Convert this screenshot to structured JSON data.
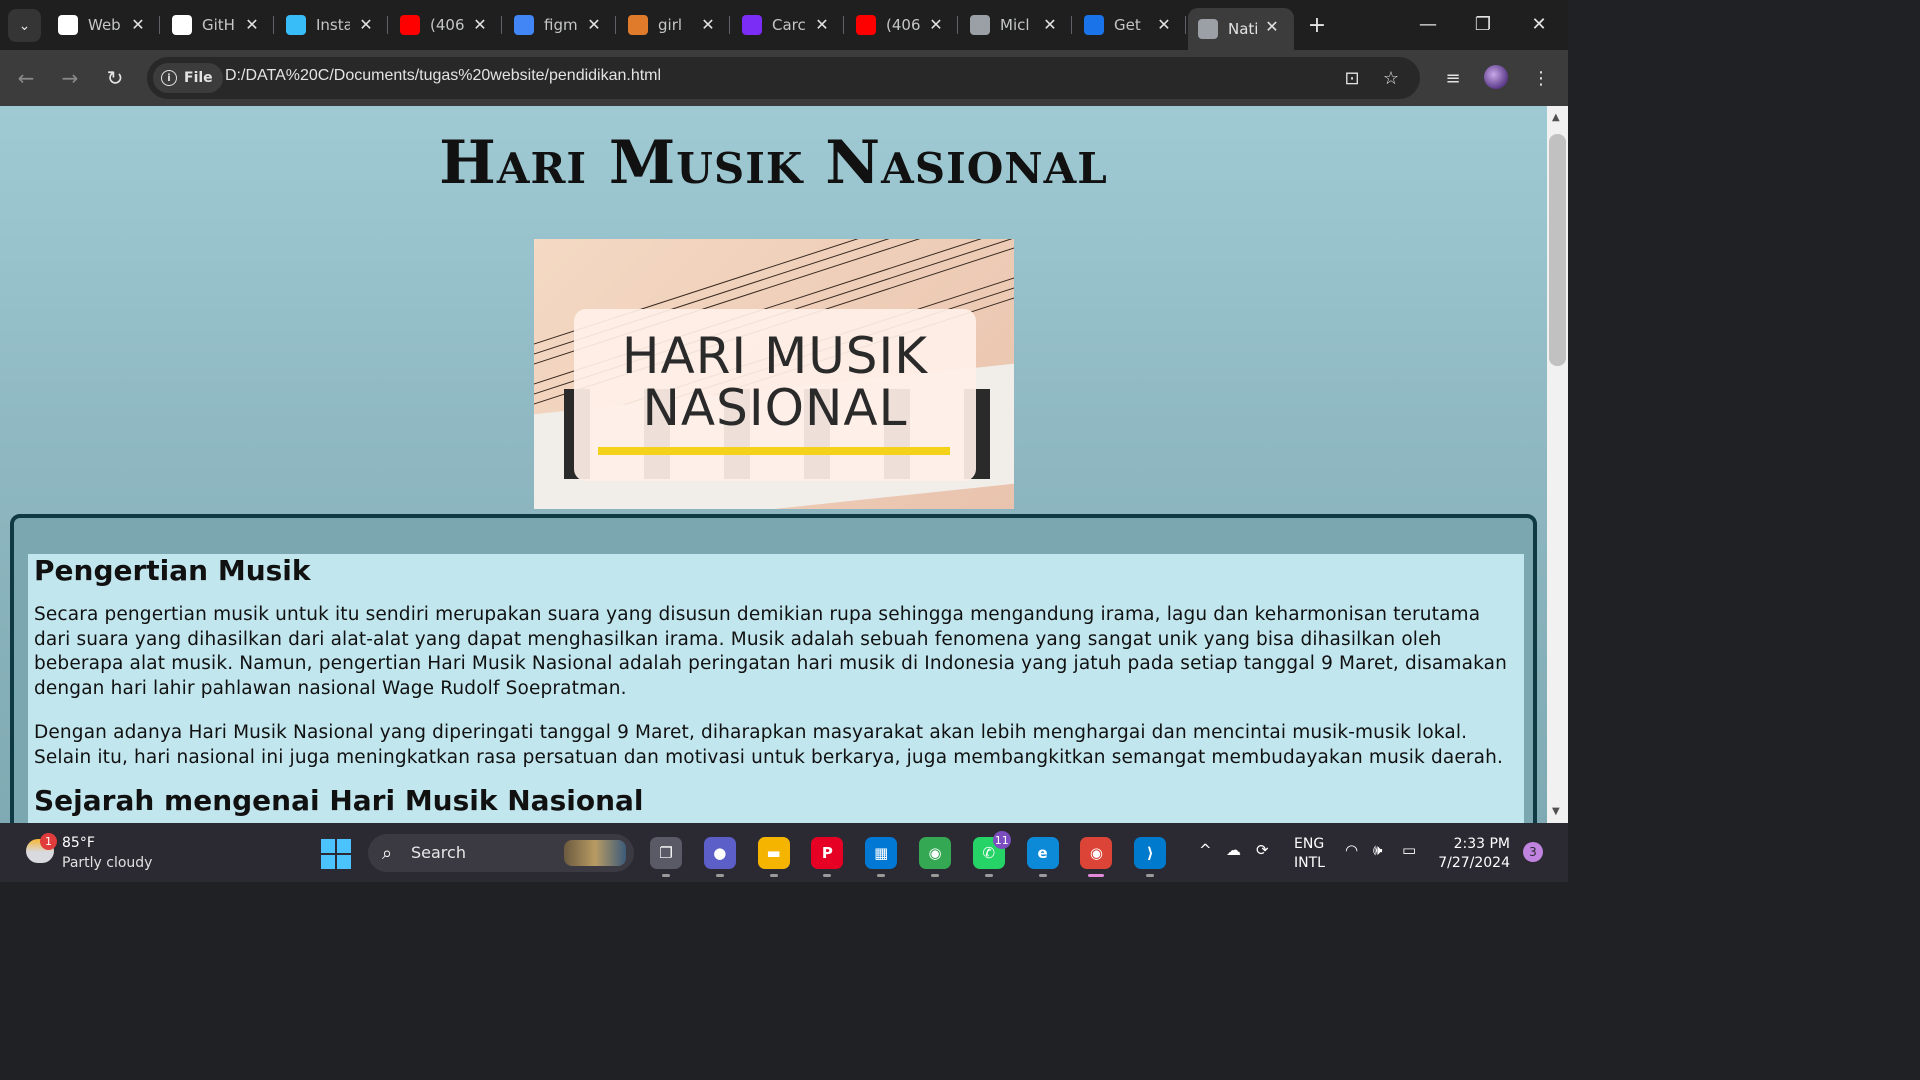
{
  "tabs": [
    {
      "title": "Web",
      "icon": "wix-icon",
      "color": "#ffffff"
    },
    {
      "title": "GitH",
      "icon": "github-icon",
      "color": "#ffffff"
    },
    {
      "title": "Insta",
      "icon": "tailwind-icon",
      "color": "#38bdf8"
    },
    {
      "title": "(406",
      "icon": "youtube-icon",
      "color": "#ff0000"
    },
    {
      "title": "figm",
      "icon": "google-icon",
      "color": "#4285f4"
    },
    {
      "title": "girl",
      "icon": "pinterest-icon",
      "color": "#e07b2c"
    },
    {
      "title": "Carc",
      "icon": "bootstrap-icon",
      "color": "#7b2cf5"
    },
    {
      "title": "(406",
      "icon": "youtube-icon",
      "color": "#ff0000"
    },
    {
      "title": "Micl",
      "icon": "globe-icon",
      "color": "#9aa0a6"
    },
    {
      "title": "Get",
      "icon": "edge-icon",
      "color": "#1a73e8"
    },
    {
      "title": "Nati",
      "icon": "globe-icon",
      "color": "#9aa0a6",
      "active": true
    }
  ],
  "toolbar": {
    "chip_label": "File",
    "url": "D:/DATA%20C/Documents/tugas%20website/pendidikan.html"
  },
  "page": {
    "title": "Hari Musik Nasional",
    "hero": {
      "line1": "HARI MUSIK",
      "line2": "NASIONAL"
    },
    "sections": [
      {
        "heading": "Pengertian Musik",
        "paragraphs": [
          "Secara pengertian musik untuk itu sendiri merupakan suara yang disusun demikian rupa sehingga mengandung irama, lagu dan keharmonisan terutama dari suara yang dihasilkan dari alat-alat yang dapat menghasilkan irama. Musik adalah sebuah fenomena yang sangat unik yang bisa dihasilkan oleh beberapa alat musik. Namun, pengertian Hari Musik Nasional adalah peringatan hari musik di Indonesia yang jatuh pada setiap tanggal 9 Maret, disamakan dengan hari lahir pahlawan nasional Wage Rudolf Soepratman.",
          "Dengan adanya Hari Musik Nasional yang diperingati tanggal 9 Maret, diharapkan masyarakat akan lebih menghargai dan mencintai musik-musik lokal. Selain itu, hari nasional ini juga meningkatkan rasa persatuan dan motivasi untuk berkarya, juga membangkitkan semangat membudayakan musik daerah."
        ]
      },
      {
        "heading": "Sejarah mengenai Hari Musik Nasional"
      }
    ]
  },
  "taskbar": {
    "weather": {
      "temp": "85°F",
      "desc": "Partly cloudy",
      "badge": "1"
    },
    "search_label": "Search",
    "apps": [
      {
        "name": "task-view",
        "glyph": "❐",
        "bg": "#5a5a66"
      },
      {
        "name": "zoom",
        "glyph": "●",
        "bg": "#5b5fc7"
      },
      {
        "name": "file-explorer",
        "glyph": "▬",
        "bg": "#f4b400"
      },
      {
        "name": "pinterest",
        "glyph": "P",
        "bg": "#e60023"
      },
      {
        "name": "microsoft-store",
        "glyph": "▦",
        "bg": "#0078d4"
      },
      {
        "name": "chrome",
        "glyph": "◉",
        "bg": "#34a853"
      },
      {
        "name": "whatsapp",
        "glyph": "✆",
        "bg": "#25d366",
        "badge": "11"
      },
      {
        "name": "edge",
        "glyph": "e",
        "bg": "#0c8ad8"
      },
      {
        "name": "chrome-profile",
        "glyph": "◉",
        "bg": "#db4437"
      },
      {
        "name": "vscode",
        "glyph": "⟩",
        "bg": "#007acc"
      }
    ],
    "lang": {
      "line1": "ENG",
      "line2": "INTL"
    },
    "clock": {
      "time": "2:33 PM",
      "date": "7/27/2024"
    },
    "notifications": "3"
  }
}
